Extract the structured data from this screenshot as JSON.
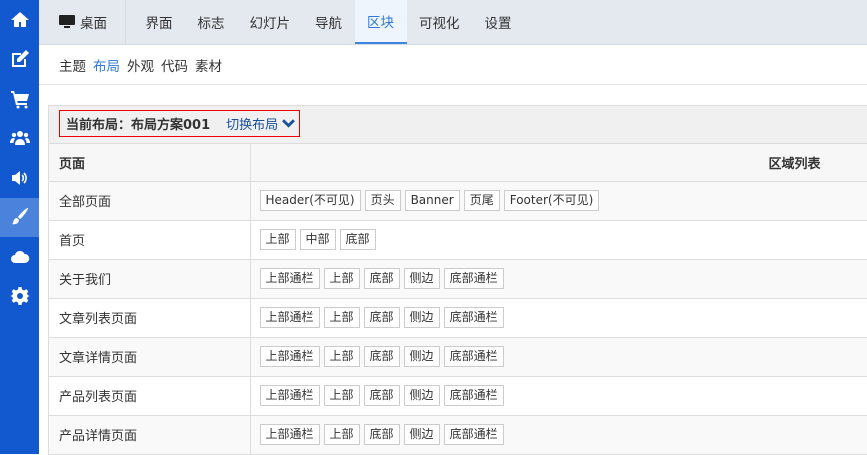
{
  "sidebar": {
    "items": [
      {
        "icon": "home-icon"
      },
      {
        "icon": "edit-icon"
      },
      {
        "icon": "cart-icon"
      },
      {
        "icon": "users-icon"
      },
      {
        "icon": "volume-icon"
      },
      {
        "icon": "brush-icon",
        "active": true
      },
      {
        "icon": "cloud-icon"
      },
      {
        "icon": "gear-icon"
      }
    ]
  },
  "topnav": {
    "desktop": "桌面",
    "tabs": [
      "界面",
      "标志",
      "幻灯片",
      "导航",
      "区块",
      "可视化",
      "设置"
    ],
    "active": "区块"
  },
  "subnav": {
    "items": [
      "主题",
      "布局",
      "外观",
      "代码",
      "素材"
    ],
    "active": "布局"
  },
  "layout": {
    "label": "当前布局：布局方案001",
    "switch": "切换布局"
  },
  "table": {
    "headers": [
      "页面",
      "区域列表"
    ],
    "rows": [
      {
        "page": "全部页面",
        "regions": [
          "Header(不可见)",
          "页头",
          "Banner",
          "页尾",
          "Footer(不可见)"
        ]
      },
      {
        "page": "首页",
        "regions": [
          "上部",
          "中部",
          "底部"
        ]
      },
      {
        "page": "关于我们",
        "regions": [
          "上部通栏",
          "上部",
          "底部",
          "侧边",
          "底部通栏"
        ]
      },
      {
        "page": "文章列表页面",
        "regions": [
          "上部通栏",
          "上部",
          "底部",
          "侧边",
          "底部通栏"
        ]
      },
      {
        "page": "文章详情页面",
        "regions": [
          "上部通栏",
          "上部",
          "底部",
          "侧边",
          "底部通栏"
        ]
      },
      {
        "page": "产品列表页面",
        "regions": [
          "上部通栏",
          "上部",
          "底部",
          "侧边",
          "底部通栏"
        ]
      },
      {
        "page": "产品详情页面",
        "regions": [
          "上部通栏",
          "上部",
          "底部",
          "侧边",
          "底部通栏"
        ]
      }
    ]
  }
}
